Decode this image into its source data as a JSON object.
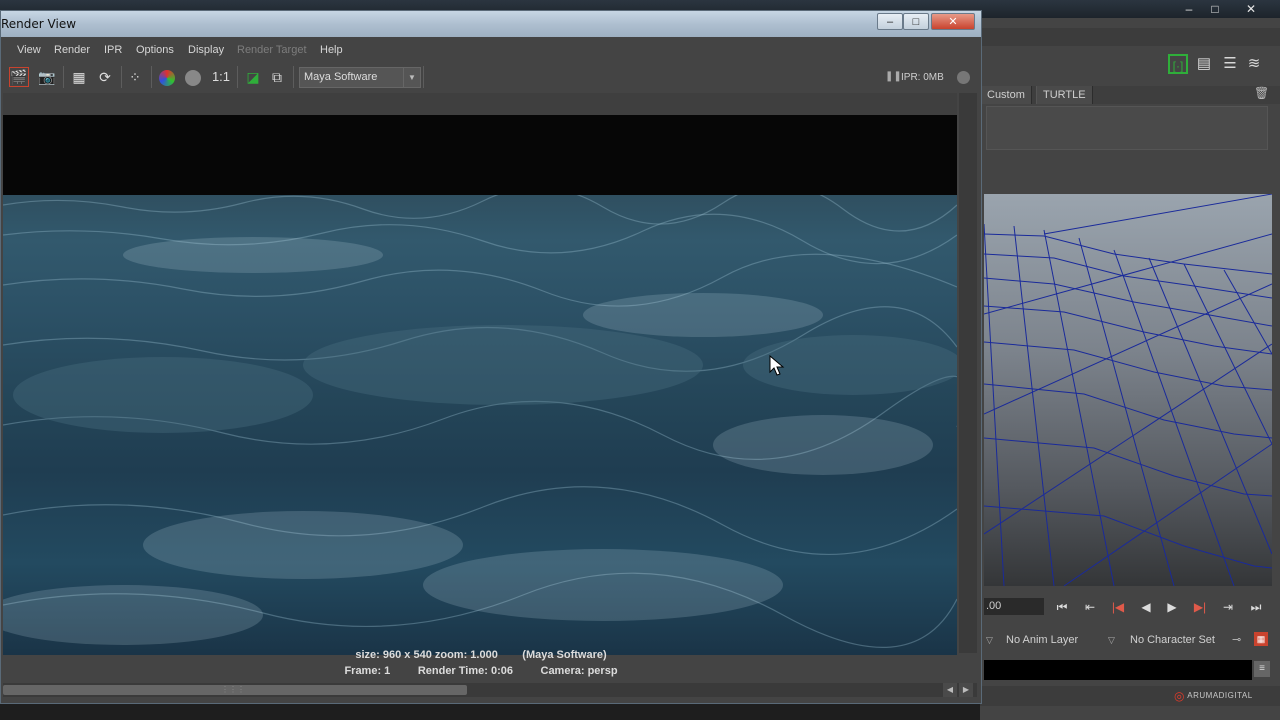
{
  "background_app": {
    "title": "",
    "window_buttons": [
      "–",
      "□",
      "✕"
    ],
    "shelf_tabs": [
      "Custom",
      "TURTLE"
    ],
    "time_field": ".00",
    "anim_layer": "No Anim Layer",
    "character_set": "No Character Set",
    "logo_text": "ARUMADIGITAL"
  },
  "render_view": {
    "title": "Render View",
    "window_buttons": [
      "–",
      "□",
      "✕"
    ],
    "menu": [
      "View",
      "Render",
      "IPR",
      "Options",
      "Display",
      "Render Target",
      "Help"
    ],
    "toolbar": {
      "ratio_label": "1:1",
      "renderer": "Maya Software",
      "ipr_memory": "IPR: 0MB"
    },
    "status": {
      "size_zoom": "size: 960 x 540 zoom: 1.000",
      "renderer_tag": "(Maya Software)",
      "frame": "Frame: 1",
      "render_time": "Render Time: 0:06",
      "camera": "Camera: persp"
    }
  },
  "colors": {
    "accent_selected": "#e0b000",
    "close_red": "#c9432e",
    "wireframe_blue": "#1a2a9a"
  }
}
